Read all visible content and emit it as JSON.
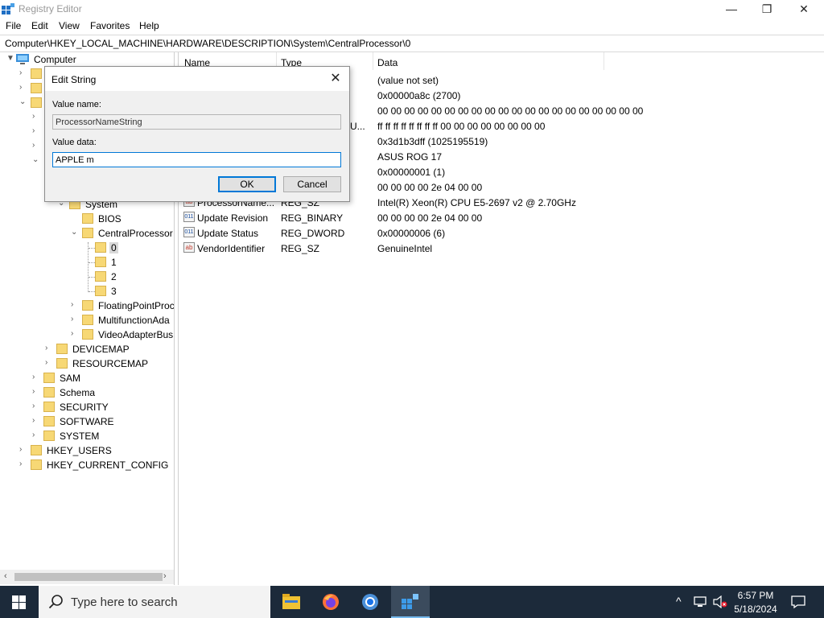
{
  "window": {
    "title": "Registry Editor",
    "controls": {
      "minimize": "—",
      "maximize": "❐",
      "close": "✕"
    }
  },
  "menu": [
    "File",
    "Edit",
    "View",
    "Favorites",
    "Help"
  ],
  "address": "Computer\\HKEY_LOCAL_MACHINE\\HARDWARE\\DESCRIPTION\\System\\CentralProcessor\\0",
  "tree": {
    "root": "Computer",
    "visible_nodes": [
      "System",
      "BIOS",
      "CentralProcessor",
      "0",
      "1",
      "2",
      "3",
      "FloatingPointProc",
      "MultifunctionAda",
      "VideoAdapterBus",
      "DEVICEMAP",
      "RESOURCEMAP",
      "SAM",
      "Schema",
      "SECURITY",
      "SOFTWARE",
      "SYSTEM",
      "HKEY_USERS",
      "HKEY_CURRENT_CONFIG"
    ]
  },
  "values": {
    "columns": {
      "name": "Name",
      "type": "Type",
      "data": "Data"
    },
    "rows": [
      {
        "name": "",
        "type": "",
        "data": "(value not set)"
      },
      {
        "name": "",
        "type": "",
        "data": "0x00000a8c (2700)"
      },
      {
        "name": "",
        "type": "",
        "data": "00 00 00 00 00 00 00 00 00 00 00 00 00 00 00 00 00 00 00 00"
      },
      {
        "name": "",
        "type": "U...",
        "data": "ff ff ff ff ff ff ff ff 00 00 00 00 00 00 00 00"
      },
      {
        "name": "",
        "type": "",
        "data": "0x3d1b3dff (1025195519)"
      },
      {
        "name": "",
        "type": "",
        "data": "ASUS ROG 17"
      },
      {
        "name": "",
        "type": "",
        "data": "0x00000001 (1)"
      },
      {
        "name": "",
        "type": "",
        "data": "00 00 00 00 2e 04 00 00"
      },
      {
        "name": "ProcessorName...",
        "type": "REG_SZ",
        "data": "Intel(R) Xeon(R) CPU E5-2697 v2 @ 2.70GHz",
        "icon": "ab"
      },
      {
        "name": "Update Revision",
        "type": "REG_BINARY",
        "data": "00 00 00 00 2e 04 00 00",
        "icon": "011"
      },
      {
        "name": "Update Status",
        "type": "REG_DWORD",
        "data": "0x00000006 (6)",
        "icon": "011"
      },
      {
        "name": "VendorIdentifier",
        "type": "REG_SZ",
        "data": "GenuineIntel",
        "icon": "ab"
      }
    ]
  },
  "dialog": {
    "title": "Edit String",
    "close": "✕",
    "value_name_label": "Value name:",
    "value_name": "ProcessorNameString",
    "value_data_label": "Value data:",
    "value_data": "APPLE m",
    "ok": "OK",
    "cancel": "Cancel"
  },
  "taskbar": {
    "search_placeholder": "Type here to search",
    "time": "6:57 PM",
    "date": "5/18/2024"
  }
}
